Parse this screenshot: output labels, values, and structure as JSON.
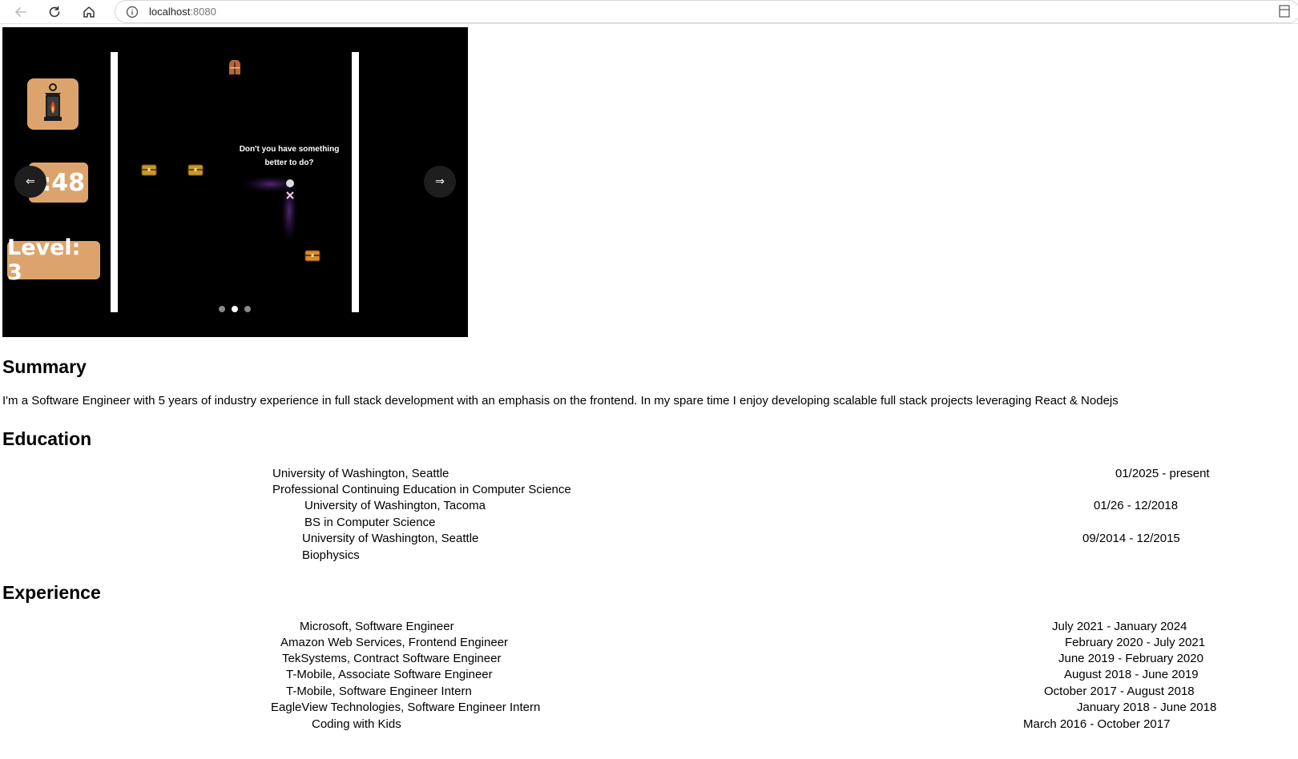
{
  "browser": {
    "url_host": "localhost",
    "url_port": ":8080"
  },
  "carousel": {
    "prev_label": "⇐",
    "next_label": "⇒",
    "slide_count": 3,
    "active_slide": 2,
    "game": {
      "timer_text": "0:48",
      "level_text": "Level: 3",
      "dialog_text": "Don't you have something better to do?"
    }
  },
  "summary": {
    "heading": "Summary",
    "text": "I'm a Software Engineer with 5 years of industry experience in full stack development with an emphasis on the frontend. In my spare time I enjoy developing scalable full stack projects leveraging React & Nodejs"
  },
  "education": {
    "heading": "Education",
    "items": [
      {
        "school": "University of Washington, Seattle",
        "program": "Professional Continuing Education in Computer Science",
        "dates": "01/2025 - present"
      },
      {
        "school": "University of Washington, Tacoma",
        "program": "BS in Computer Science",
        "dates": "01/26 - 12/2018"
      },
      {
        "school": "University of Washington, Seattle",
        "program": "Biophysics",
        "dates": "09/2014 - 12/2015"
      }
    ]
  },
  "experience": {
    "heading": "Experience",
    "items": [
      {
        "title": "Microsoft, Software Engineer",
        "dates": "July 2021 - January 2024"
      },
      {
        "title": "Amazon Web Services, Frontend Engineer",
        "dates": "February 2020 - July 2021"
      },
      {
        "title": "TekSystems, Contract Software Engineer",
        "dates": "June 2019 - February 2020"
      },
      {
        "title": "T-Mobile, Associate Software Engineer",
        "dates": "August 2018 - June 2019"
      },
      {
        "title": "T-Mobile, Software Engineer Intern",
        "dates": "October 2017 - August 2018"
      },
      {
        "title": "EagleView Technologies, Software Engineer Intern",
        "dates": "January 2018 - June 2018"
      },
      {
        "title": "Coding with Kids",
        "dates": "March 2016 - October 2017"
      }
    ]
  },
  "colors": {
    "hud_tan": "#dca46c",
    "carousel_bg": "#000000",
    "chest_gold": "#c9962e"
  },
  "icons": [
    "back-arrow-icon",
    "reload-icon",
    "home-icon",
    "info-icon",
    "lantern-icon",
    "treasure-chest-icon",
    "door-icon"
  ]
}
